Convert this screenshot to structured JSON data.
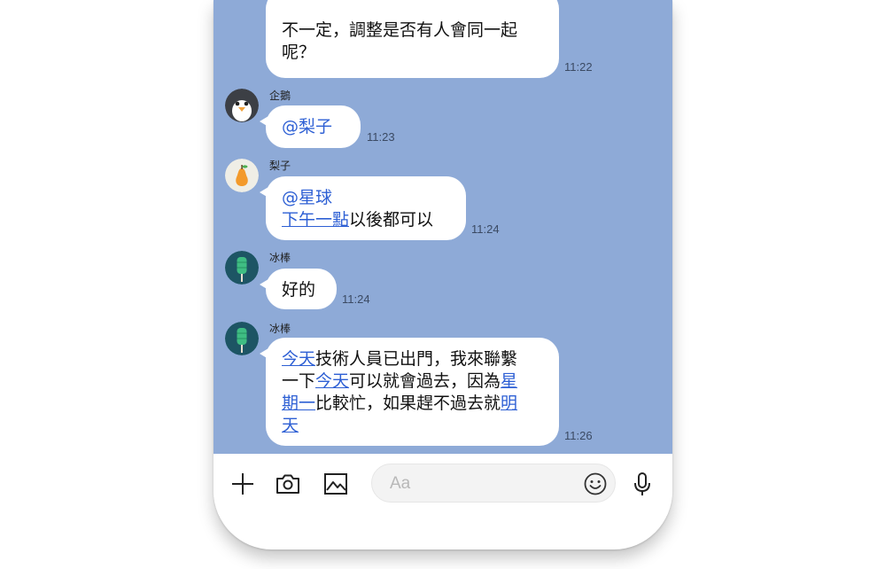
{
  "messages": [
    {
      "sender": "",
      "line1": "不一定，調整是否有人會同一起",
      "line2": "呢？",
      "time": "11:22"
    },
    {
      "sender": "企鵝",
      "mention": "@梨子",
      "time": "11:23",
      "avatar": "penguin-avatar"
    },
    {
      "sender": "梨子",
      "mention": "@星球",
      "link": "下午一點",
      "text": "以後都可以",
      "time": "11:24",
      "avatar": "pear-avatar"
    },
    {
      "sender": "冰棒",
      "text": "好的",
      "time": "11:24",
      "avatar": "popsicle-avatar"
    },
    {
      "sender": "冰棒",
      "time": "11:26",
      "avatar": "popsicle-avatar",
      "seg": {
        "l1_link": "今天",
        "l1_text": "技術人員已出門，我來聯繫",
        "l2_text_a": "一下",
        "l2_link": "今天",
        "l2_text_b": "可以就會過去，因為",
        "l2_link2": "星",
        "l3_link": "期一",
        "l3_text": "比較忙，如果趕不過去就",
        "l3_link2": "明",
        "l4_link": "天"
      }
    }
  ],
  "input_bar": {
    "placeholder": "Aa",
    "icons": [
      "plus-icon",
      "camera-icon",
      "image-icon",
      "emoji-icon",
      "microphone-icon"
    ]
  },
  "colors": {
    "chat_background": "#8eaad7",
    "link": "#2d5fd4",
    "bubble": "#ffffff"
  }
}
